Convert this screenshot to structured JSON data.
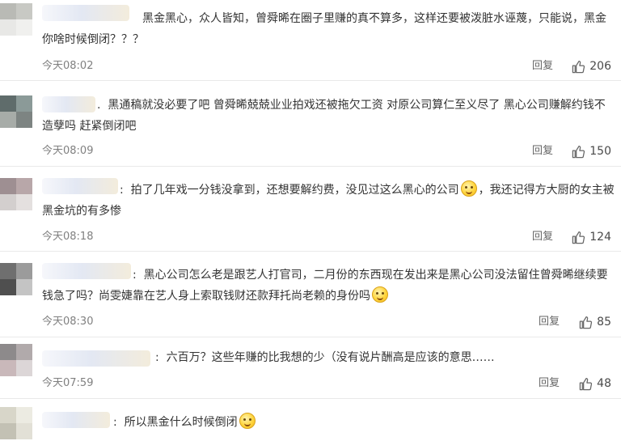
{
  "reply_label": "回复",
  "comments": [
    {
      "separator": "",
      "text": "黑金黑心，众人皆知，曾舜晞在圈子里赚的真不算多，这样还要被泼脏水诬蔑，只能说，黑金你啥时候倒闭？？？",
      "text_after": "",
      "time": "今天08:02",
      "likes": "206"
    },
    {
      "separator": ".",
      "text": "黑通稿就没必要了吧 曾舜晞兢兢业业拍戏还被拖欠工资 对原公司算仁至义尽了 黑心公司赚解约钱不造孽吗 赶紧倒闭吧",
      "text_after": "",
      "time": "今天08:09",
      "likes": "150"
    },
    {
      "separator": ":",
      "text": "拍了几年戏一分钱没拿到，还想要解约费，没见过这么黑心的公司",
      "text_after": "，我还记得方大厨的女主被黑金坑的有多惨",
      "time": "今天08:18",
      "likes": "124"
    },
    {
      "separator": ":",
      "text": "黑心公司怎么老是跟艺人打官司，二月份的东西现在发出来是黑心公司没法留住曾舜晞继续要钱急了吗？尚雯婕靠在艺人身上索取钱财还款拜托尚老赖的身份吗",
      "text_after": "",
      "time": "今天08:30",
      "likes": "85"
    },
    {
      "separator": ":",
      "text": "六百万？这些年赚的比我想的少（没有说片酬高是应该的意思……",
      "text_after": "",
      "time": "今天07:59",
      "likes": "48"
    },
    {
      "separator": ":",
      "text": "所以黑金什么时候倒闭",
      "text_after": "",
      "time": "",
      "likes": ""
    }
  ],
  "colors": {
    "text": "#333333",
    "meta": "#808080",
    "divider": "#e9e9e9",
    "emoji": "#ffd53d"
  },
  "icons": {
    "like": "thumbs-up-icon",
    "emoji": "smile-emoji-icon"
  }
}
